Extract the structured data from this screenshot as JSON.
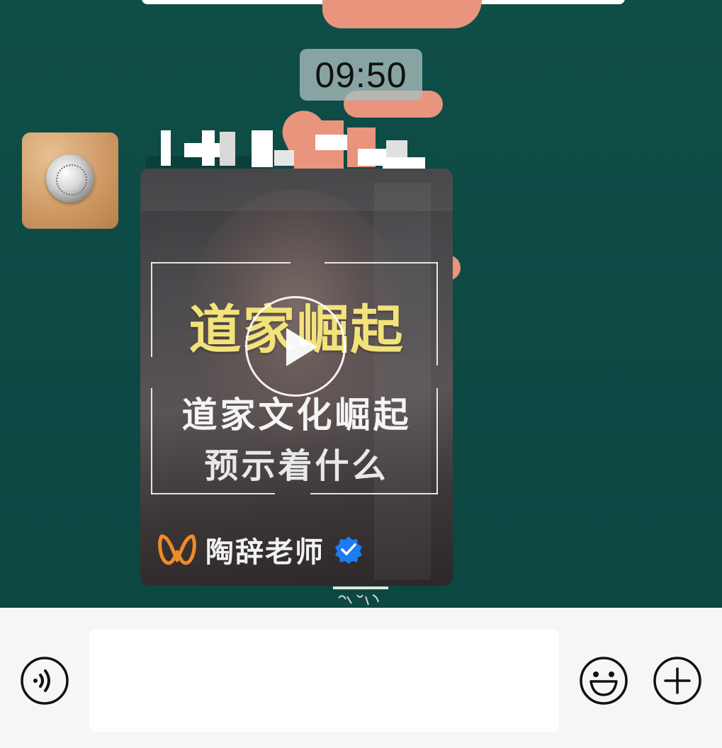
{
  "chat": {
    "timestamp": "09:50",
    "video": {
      "headline": "道家崛起",
      "subtitle_line1": "道家文化崛起",
      "subtitle_line2": "预示着什么",
      "author": "陶辞老师",
      "author_verified": true,
      "headline_color": "#f2e27a",
      "verified_color": "#1d7cf2"
    }
  },
  "input_bar": {
    "message_value": "",
    "message_placeholder": ""
  },
  "icons": {
    "voice": "voice-icon",
    "emoji": "emoji-icon",
    "plus": "plus-icon",
    "play": "play-icon",
    "verified": "verified-badge-icon"
  },
  "theme": {
    "wallpaper": "#0d4a45",
    "accent_brush": "#e9947c",
    "input_bar_bg": "#f6f6f6"
  }
}
